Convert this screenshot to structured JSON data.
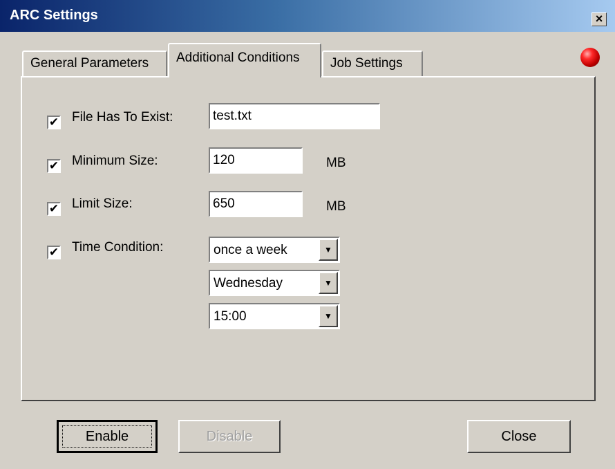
{
  "window": {
    "title": "ARC Settings",
    "close_label": "×"
  },
  "tabs": [
    {
      "label": "General Parameters",
      "selected": false
    },
    {
      "label": "Additional Conditions",
      "selected": true
    },
    {
      "label": "Job Settings",
      "selected": false
    }
  ],
  "status_indicator": {
    "icon": "red-led-icon",
    "color": "#cc0000"
  },
  "conditions": {
    "file_exists": {
      "checked": true,
      "label": "File Has To Exist:",
      "value": "test.txt"
    },
    "minimum_size": {
      "checked": true,
      "label": "Minimum Size:",
      "value": "120",
      "unit": "MB"
    },
    "limit_size": {
      "checked": true,
      "label": "Limit Size:",
      "value": "650",
      "unit": "MB"
    },
    "time_condition": {
      "checked": true,
      "label": "Time Condition:",
      "frequency": "once a week",
      "day": "Wednesday",
      "time": "15:00"
    }
  },
  "checkmark": "✔",
  "dropdown_arrow": "▼",
  "buttons": {
    "enable": "Enable",
    "disable": "Disable",
    "close": "Close"
  }
}
